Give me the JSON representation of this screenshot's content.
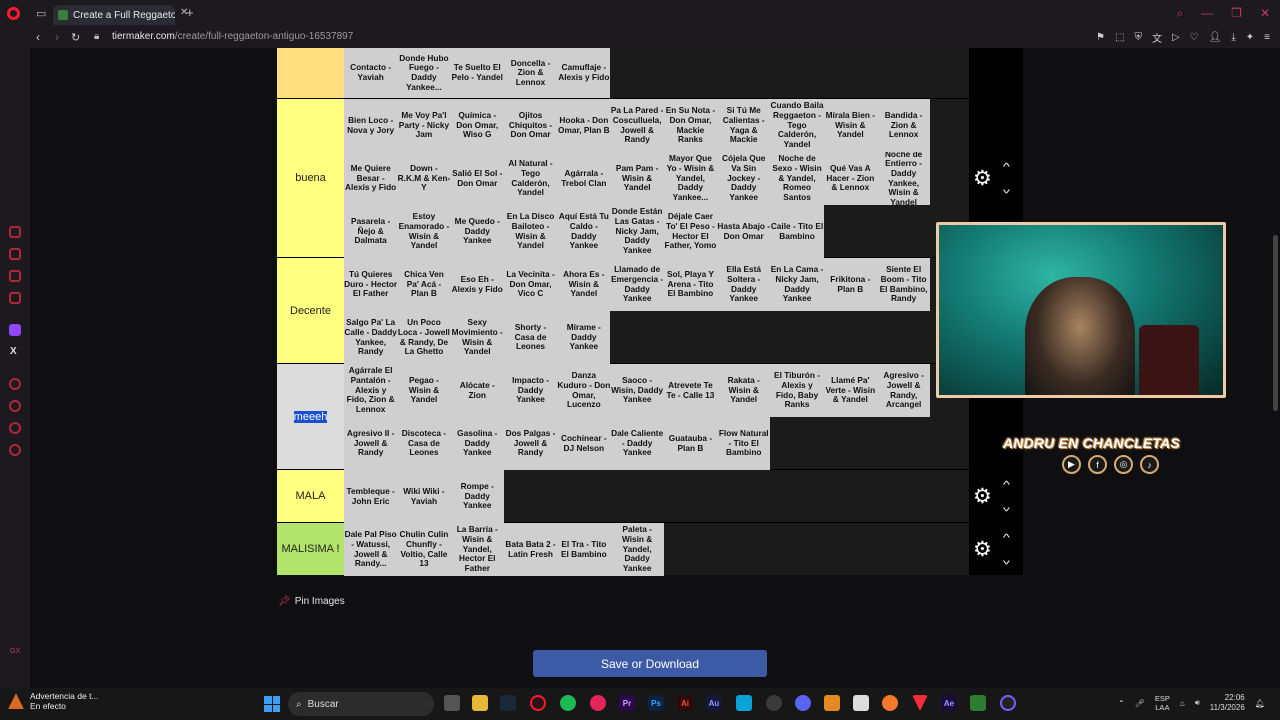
{
  "browser": {
    "tab_title": "Create a Full Reggaeton Antiguo Tier List",
    "url_host": "tiermaker.com",
    "url_path": "/create/full-reggaeton-antiguo-16537897"
  },
  "tiers": [
    {
      "label": "",
      "color": "#ffdf80",
      "controls": false,
      "items": [
        "Contacto - Yaviah",
        "Donde Hubo Fuego - Daddy Yankee...",
        "Te Suelto El Pelo - Yandel",
        "Doncella - Zion & Lennox",
        "Camuflaje - Alexis y Fido"
      ]
    },
    {
      "label": "buena",
      "color": "#ffff80",
      "controls": true,
      "items": [
        "Bien Loco - Nova y Jory",
        "Me Voy Pa'l Party - Nicky Jam",
        "Química - Don Omar, Wiso G",
        "Ojitos Chiquitos - Don Omar",
        "Hooka - Don Omar, Plan B",
        "Pa La Pared - Cosculluela, Jowell & Randy",
        "En Su Nota - Don Omar, Mackie Ranks",
        "Si Tú Me Calientas - Yaga & Mackie",
        "Cuando Baila Reggaeton - Tego Calderón, Yandel",
        "Mírala Bien - Wisin & Yandel",
        "Bandida - Zion & Lennox",
        "Me Quiere Besar - Alexis y Fido",
        "Down - R.K.M & Ken-Y",
        "Salió El Sol - Don Omar",
        "Al Natural - Tego Calderón, Yandel",
        "Agárrala - Trebol Clan",
        "Pam Pam - Wisin & Yandel",
        "Mayor Que Yo - Wisin & Yandel, Daddy Yankee...",
        "Cójela Que Va Sin Jockey - Daddy Yankee",
        "Noche de Sexo - Wisin & Yandel, Romeo Santos",
        "Qué Vas A Hacer - Zion & Lennox",
        "Noche de Entierro - Daddy Yankee, Wisin & Yandel",
        "Pasarela - Ñejo & Dalmata",
        "Estoy Enamorado - Wisin & Yandel",
        "Me Quedo - Daddy Yankee",
        "En La Disco Bailoteo - Wisin & Yandel",
        "Aquí Está Tu Caldo - Daddy Yankee",
        "Donde Están Las Gatas - Nicky Jam, Daddy Yankee",
        "Déjale Caer To' El Peso - Hector El Father, Yomo",
        "Hasta Abajo - Don Omar",
        "Caile - Tito El Bambino"
      ]
    },
    {
      "label": "Decente",
      "color": "#ffff80",
      "controls": false,
      "items": [
        "Tú Quieres Duro - Hector El Father",
        "Chica Ven Pa' Acá - Plan B",
        "Eso Eh - Alexis y Fido",
        "La Vecinita - Don Omar, Vico C",
        "Ahora Es - Wisin & Yandel",
        "Llamado de Emergencia - Daddy Yankee",
        "Sol, Playa Y Arena - Tito El Bambino",
        "Ella Está Soltera - Daddy Yankee",
        "En La Cama - Nicky Jam, Daddy Yankee",
        "Frikitona - Plan B",
        "Siente El Boom - Tito El Bambino, Randy",
        "Salgo Pa' La Calle - Daddy Yankee, Randy",
        "Un Poco Loca - Jowell & Randy, De La Ghetto",
        "Sexy Movimiento - Wisin & Yandel",
        "Shorty - Casa de Leones",
        "Mírame - Daddy Yankee"
      ]
    },
    {
      "label": "meeeh",
      "color": "#dcdcdc",
      "controls": false,
      "highlight": true,
      "items": [
        "Agárrale El Pantalón - Alexis y Fido, Zion & Lennox",
        "Pegao - Wisin & Yandel",
        "Alócate - Zion",
        "Impacto - Daddy Yankee",
        "Danza Kuduro - Don Omar, Lucenzo",
        "Saoco - Wisin, Daddy Yankee",
        "Atrevete Te Te - Calle 13",
        "Rakata - Wisin & Yandel",
        "El Tiburón - Alexis y Fido, Baby Ranks",
        "Llamé Pa' Verte - Wisin & Yandel",
        "Agresivo - Jowell & Randy, Arcangel",
        "Agresivo II - Jowell & Randy",
        "Discoteca - Casa de Leones",
        "Gasolina - Daddy Yankee",
        "Dos Palgas - Jowell & Randy",
        "Cochinear - DJ Nelson",
        "Dale Caliente - Daddy Yankee",
        "Guatauba - Plan B",
        "Flow Natural - Tito El Bambino"
      ]
    },
    {
      "label": "MALA",
      "color": "#ffff80",
      "controls": true,
      "items": [
        "Tembleque - John Eric",
        "Wiki Wiki - Yaviah",
        "Rompe - Daddy Yankee"
      ]
    },
    {
      "label": "MALISIMA !",
      "color": "#b2e36a",
      "controls": true,
      "items": [
        "Dale Pal Piso - Watussi, Jowell & Randy...",
        "Chulin Culin Chunfly - Voltio, Calle 13",
        "La Barría - Wisin & Yandel, Hector El Father",
        "Bata Bata 2 - Latin Fresh",
        "El Tra - Tito El Bambino",
        "Paleta - Wisin & Yandel, Daddy Yankee"
      ]
    }
  ],
  "pin_label": "Pin Images",
  "save_label": "Save or Download",
  "stream": {
    "name": "ANDRU EN CHANCLETAS"
  },
  "taskbar": {
    "notif_title": "Advertencia de t...",
    "notif_sub": "En efecto",
    "search_placeholder": "Buscar",
    "lang": "ESP",
    "lang_sub": "LAA",
    "time": "22:06",
    "date": "11/3/2026"
  }
}
